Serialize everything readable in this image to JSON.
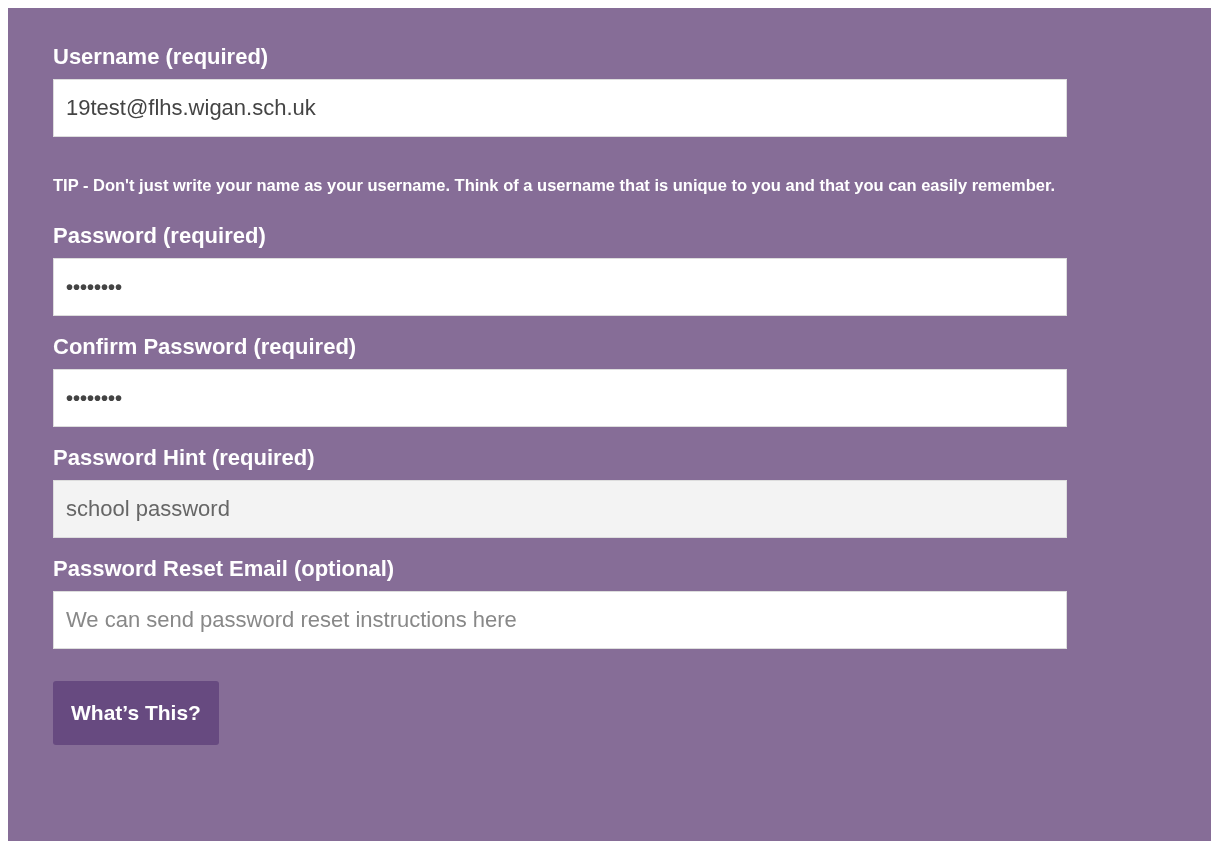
{
  "fields": [
    {
      "label": "Username (required)",
      "kind": "text",
      "value": "19test@flhs.wigan.sch.uk",
      "disabled": false
    },
    {
      "kind": "tip",
      "text": "TIP - Don't just write your name as your username. Think of a username that is unique to you and that you can easily remember."
    },
    {
      "label": "Password (required)",
      "kind": "password",
      "value": "••••••••",
      "disabled": false
    },
    {
      "label": "Confirm Password (required)",
      "kind": "password",
      "value": "••••••••",
      "disabled": false
    },
    {
      "label": "Password Hint (required)",
      "kind": "text",
      "value": "school password",
      "disabled": true
    },
    {
      "label": "Password Reset Email (optional)",
      "kind": "text",
      "placeholder": "We can send password reset instructions here",
      "disabled": false
    }
  ],
  "button": "What’s This?"
}
